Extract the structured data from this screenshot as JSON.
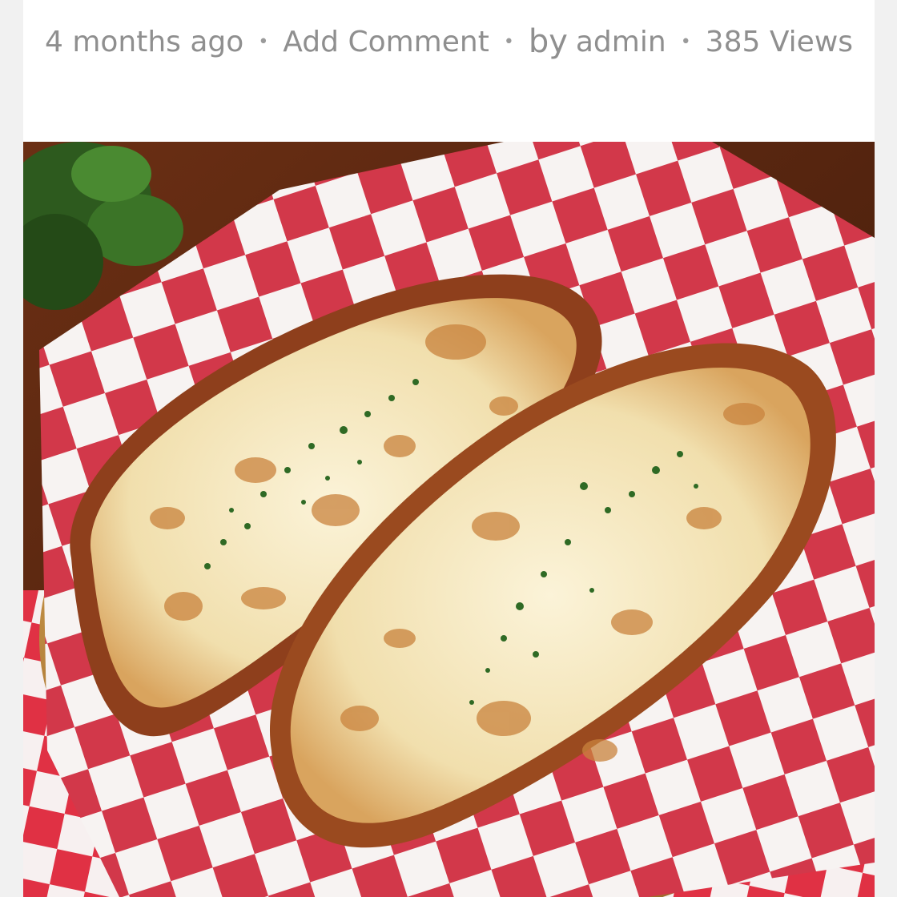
{
  "post_meta": {
    "time_ago": "4 months ago",
    "comment_link": "Add Comment",
    "by_prefix": "by",
    "author": "admin",
    "views": "385 Views",
    "separator": "•"
  },
  "photo": {
    "subject": "cheesy garlic bread on red-white checkered paper in wicker basket"
  },
  "colors": {
    "meta_text": "#8f8f8f",
    "card_bg": "#ffffff",
    "page_bg": "#f1f1f1",
    "checker_red": "#d2384a",
    "cheese": "#f4e6bd",
    "crust": "#a8522a",
    "basket": "#c7923f",
    "parsley": "#2f6a24"
  }
}
